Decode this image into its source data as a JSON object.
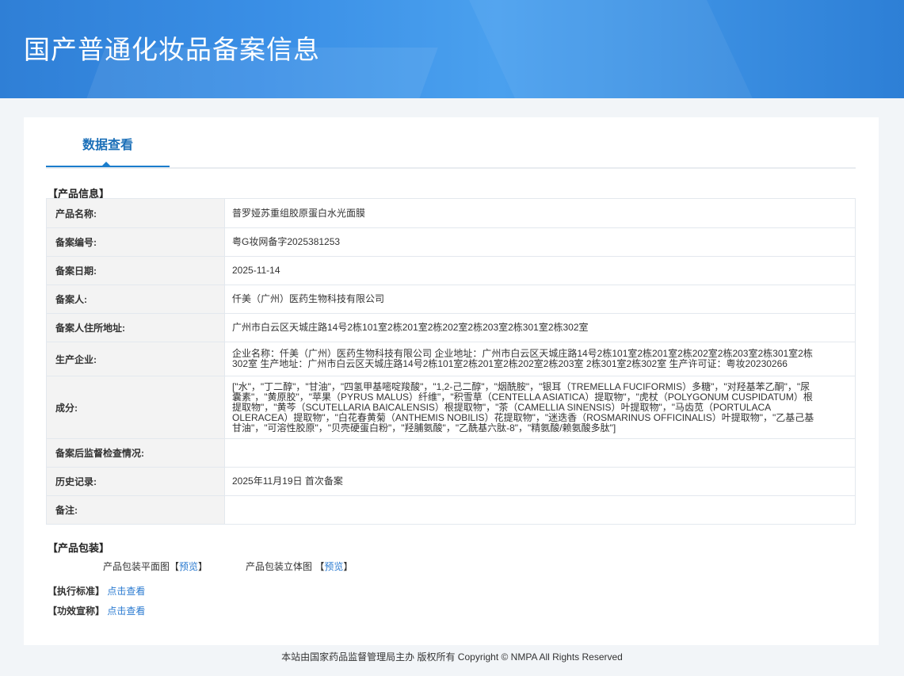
{
  "header": {
    "title": "国产普通化妆品备案信息"
  },
  "tabs": [
    {
      "label": "数据查看"
    }
  ],
  "product_section": "【产品信息】",
  "rows": [
    {
      "label": "产品名称:",
      "value": "普罗娅苏重组胶原蛋白水光面膜"
    },
    {
      "label": "备案编号:",
      "value": "粤G妆网备字2025381253"
    },
    {
      "label": "备案日期:",
      "value": "2025-11-14"
    },
    {
      "label": "备案人:",
      "value": "仟美（广州）医药生物科技有限公司"
    },
    {
      "label": "备案人住所地址:",
      "value": "广州市白云区天城庄路14号2栋101室2栋201室2栋202室2栋203室2栋301室2栋302室"
    },
    {
      "label": "生产企业:",
      "value": "企业名称：仟美（广州）医药生物科技有限公司 企业地址：广州市白云区天城庄路14号2栋101室2栋201室2栋202室2栋203室2栋301室2栋302室 生产地址：广州市白云区天城庄路14号2栋101室2栋201室2栋202室2栋203室 2栋301室2栋302室 生产许可证：粤妆20230266"
    },
    {
      "label": "成分:",
      "value": "[\"水\"，\"丁二醇\"，\"甘油\"，\"四氢甲基嘧啶羧酸\"，\"1,2-己二醇\"，\"烟酰胺\"，\"银耳（TREMELLA FUCIFORMIS）多糖\"，\"对羟基苯乙酮\"，\"尿囊素\"，\"黄原胶\"，\"苹果（PYRUS MALUS）纤维\"，\"积雪草（CENTELLA ASIATICA）提取物\"，\"虎杖（POLYGONUM CUSPIDATUM）根提取物\"，\"黄芩（SCUTELLARIA BAICALENSIS）根提取物\"，\"茶（CAMELLIA SINENSIS）叶提取物\"，\"马齿苋（PORTULACA OLERACEA）提取物\"，\"白花春黄菊（ANTHEMIS NOBILIS）花提取物\"，\"迷迭香（ROSMARINUS OFFICINALIS）叶提取物\"，\"乙基己基甘油\"，\"可溶性胶原\"，\"贝壳硬蛋白粉\"，\"羟脯氨酸\"，\"乙酰基六肽-8\"，\"精氨酸/赖氨酸多肽\"]"
    },
    {
      "label": "备案后监督检查情况:",
      "value": ""
    },
    {
      "label": "历史记录:",
      "value": "2025年11月19日 首次备案"
    },
    {
      "label": "备注:",
      "value": ""
    }
  ],
  "packaging": {
    "title": "【产品包装】",
    "flat_label": "产品包装平面图",
    "solid_label": "产品包装立体图",
    "bracket_open": "【",
    "bracket_close": "】",
    "preview": "预览"
  },
  "standard": {
    "title": "【执行标准】",
    "link": "点击查看"
  },
  "efficacy": {
    "title": "【功效宣称】",
    "link": "点击查看"
  },
  "footer": {
    "text": "本站由国家药品监督管理局主办 版权所有 Copyright © NMPA All Rights Reserved"
  }
}
